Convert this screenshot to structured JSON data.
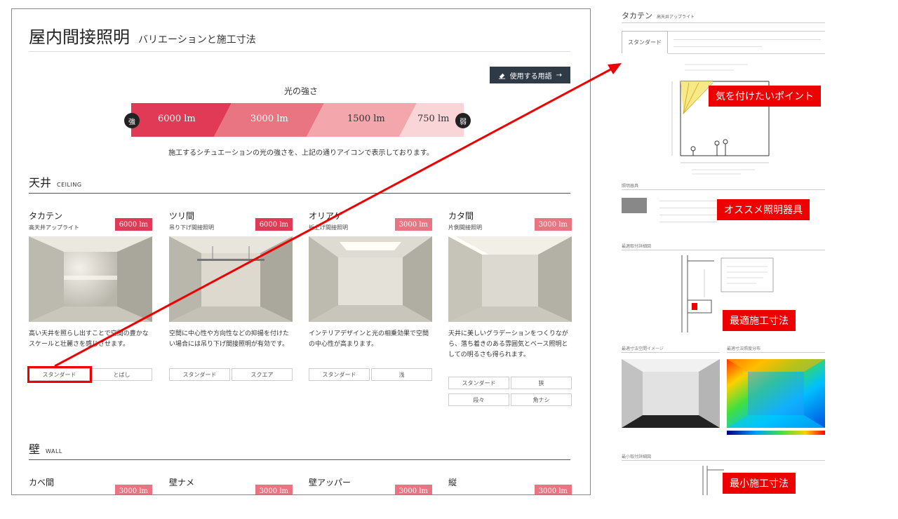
{
  "left": {
    "title": "屋内間接照明",
    "subtitle": "バリエーションと施工寸法",
    "terms_button": "使用する用語",
    "strength_label": "光の強さ",
    "bar": {
      "strong": "強",
      "weak": "弱",
      "segments": [
        {
          "label": "6000 lm",
          "color": "#e03a56"
        },
        {
          "label": "3000 lm",
          "color": "#ea7582"
        },
        {
          "label": "1500 lm",
          "color": "#f3a6ab"
        },
        {
          "label": "750 lm",
          "color": "#f9d5d7"
        }
      ]
    },
    "bar_note": "施工するシチュエーションの光の強さを、上記の通りアイコンで表示しております。",
    "ceiling": {
      "jp": "天井",
      "en": "CEILING",
      "cards": [
        {
          "name": "タカテン",
          "sub": "高天井アップライト",
          "lm": "6000 lm",
          "lm_color": "#e03a56",
          "desc": "高い天井を照らし出すことで空間の豊かなスケールと壮麗さを感じさせます。",
          "tags": [
            "スタンダード",
            "とばし"
          ]
        },
        {
          "name": "ツリ間",
          "sub": "吊り下げ間接照明",
          "lm": "6000 lm",
          "lm_color": "#e03a56",
          "desc": "空間に中心性や方向性などの抑揚を付けたい場合には吊り下げ間接照明が有効です。",
          "tags": [
            "スタンダード",
            "スクエア"
          ]
        },
        {
          "name": "オリアゲ",
          "sub": "折上げ間接照明",
          "lm": "3000 lm",
          "lm_color": "#ea7582",
          "desc": "インテリアデザインと光の相乗効果で空間の中心性が高まります。",
          "tags": [
            "スタンダード",
            "浅"
          ]
        },
        {
          "name": "カタ間",
          "sub": "片側間接照明",
          "lm": "3000 lm",
          "lm_color": "#ea7582",
          "desc": "天井に美しいグラデーションをつくりながら、落ち着きのある雰囲気とベース照明としての明るさも得られます。",
          "tags": [
            "スタンダード",
            "狭",
            "段々",
            "角ナシ"
          ]
        }
      ]
    },
    "wall": {
      "jp": "壁",
      "en": "WALL",
      "cards": [
        {
          "name": "カベ間",
          "lm": "3000 lm"
        },
        {
          "name": "壁ナメ",
          "lm": "3000 lm"
        },
        {
          "name": "壁アッパー",
          "lm": "3000 lm"
        },
        {
          "name": "縦",
          "lm": "3000 lm"
        }
      ]
    }
  },
  "right": {
    "title": "タカテン",
    "title_sub": "高天井アップライト",
    "tab": "スタンダード",
    "sec_fixture": "照明器具",
    "sec_detail": "最適取付詳細図",
    "sec_image": "最適寸法空間イメージ",
    "sec_dist": "最適寸法照度分布",
    "sec_min": "最小取付詳細図",
    "annotations": [
      "気を付けたいポイント",
      "オススメ照明器具",
      "最適施工寸法",
      "最小施工寸法"
    ]
  }
}
